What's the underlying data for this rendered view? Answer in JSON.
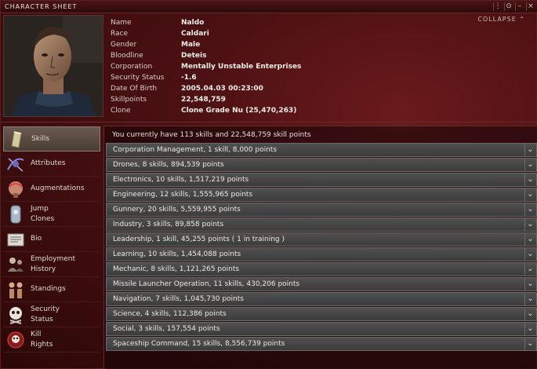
{
  "window": {
    "title": "CHARACTER SHEET",
    "collapse_label": "COLLAPSE ⌃",
    "buttons": [
      "⋮",
      "⊙",
      "–",
      "×"
    ]
  },
  "character": {
    "rows": [
      {
        "label": "Name",
        "value": "Naldo"
      },
      {
        "label": "Race",
        "value": "Caldari"
      },
      {
        "label": "Gender",
        "value": "Male"
      },
      {
        "label": "Bloodline",
        "value": "Deteis"
      },
      {
        "label": "Corporation",
        "value": "Mentally Unstable Enterprises"
      },
      {
        "label": "Security Status",
        "value": "-1.6"
      },
      {
        "label": "Date Of Birth",
        "value": "2005.04.03  00:23:00"
      },
      {
        "label": "Skillpoints",
        "value": "22,548,759"
      },
      {
        "label": "Clone",
        "value": "Clone Grade Nu (25,470,263)"
      }
    ]
  },
  "sidebar": {
    "items": [
      {
        "label": "Skills",
        "icon": "skills-icon",
        "active": true
      },
      {
        "label": "Attributes",
        "icon": "attributes-icon"
      },
      {
        "label": "Augmentations",
        "icon": "augmentations-icon"
      },
      {
        "label": "Jump\nClones",
        "icon": "jump-clones-icon"
      },
      {
        "label": "Bio",
        "icon": "bio-icon"
      },
      {
        "label": "Employment\nHistory",
        "icon": "employment-history-icon"
      },
      {
        "label": "Standings",
        "icon": "standings-icon"
      },
      {
        "label": "Security\nStatus",
        "icon": "security-status-icon"
      },
      {
        "label": "Kill\nRights",
        "icon": "kill-rights-icon"
      }
    ]
  },
  "skills": {
    "summary": "You currently have 113 skills and 22,548,759 skill points",
    "groups": [
      "Corporation Management, 1  skill, 8,000  points",
      "Drones, 8  skills, 894,539  points",
      "Electronics, 10  skills, 1,517,219  points",
      "Engineering, 12  skills, 1,555,965  points",
      "Gunnery, 20  skills, 5,559,955  points",
      "Industry, 3  skills, 89,858  points",
      "Leadership, 1  skill, 45,255  points  ( 1  in training )",
      "Learning, 10  skills, 1,454,088  points",
      "Mechanic, 8  skills, 1,121,265  points",
      "Missile Launcher Operation, 11  skills, 430,206  points",
      "Navigation, 7  skills, 1,045,730  points",
      "Science, 4  skills, 112,386  points",
      "Social, 3  skills, 157,554  points",
      "Spaceship Command, 15  skills, 8,556,739  points"
    ],
    "chevron": "⌄"
  }
}
